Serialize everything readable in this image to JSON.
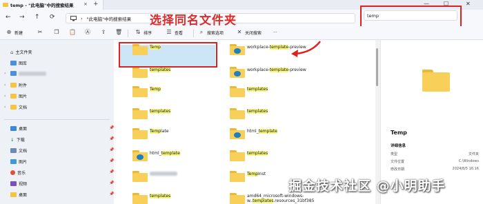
{
  "window": {
    "tab_title": "temp - \"此电脑\"中的搜索结果",
    "tab_close": "×",
    "tab_add": "+",
    "minimize": "—",
    "maximize": "☐",
    "close": "✕"
  },
  "nav": {
    "back": "←",
    "forward": "→",
    "up": "↑",
    "refresh": "⟳",
    "computer_icon": "computer-icon",
    "breadcrumb_sep": "›",
    "breadcrumb": "\"此电脑\"中的搜索结果"
  },
  "annotation": {
    "title": "选择同名文件夹"
  },
  "search": {
    "value": "temp"
  },
  "toolbar": {
    "new_label": "新建",
    "sort_label": "排序",
    "view_label": "查看",
    "search_options_label": "搜索选项",
    "close_search_label": "关闭搜索",
    "more_label": "..."
  },
  "sidebar": {
    "home": "主文件夹",
    "gallery": "图库",
    "attachments": "附件",
    "pictures": "图片",
    "documents": "文档",
    "desktop": "桌面",
    "downloads": "下载",
    "documents2": "文档",
    "pictures2": "图片",
    "music": "音乐",
    "videos": "视频",
    "desktop2": "桌面",
    "chevron": "›",
    "pin": "📌"
  },
  "files": {
    "col1": [
      {
        "pre": "",
        "hl": "Temp",
        "post": ""
      },
      {
        "pre": "",
        "hl": "templates",
        "post": ""
      },
      {
        "pre": "",
        "hl": "Temp",
        "post": ""
      },
      {
        "pre": "",
        "hl": "templates",
        "post": ""
      },
      {
        "pre": "",
        "hl": "Temp",
        "post": "late"
      },
      {
        "pre": "html_",
        "hl": "template",
        "post": ""
      },
      {
        "pre": "",
        "hl": "",
        "post": ""
      },
      {
        "pre": "",
        "hl": "templates",
        "post": ""
      }
    ],
    "col2": [
      {
        "pre": "workplace-",
        "hl": "template",
        "post": "-preview"
      },
      {
        "pre": "workplace-",
        "hl": "template",
        "post": "-preview"
      },
      {
        "pre": "",
        "hl": "templates",
        "post": ""
      },
      {
        "pre": "",
        "hl": "templates",
        "post": ""
      },
      {
        "pre": "html_",
        "hl": "template",
        "post": ""
      },
      {
        "pre": "",
        "hl": "templates",
        "post": ""
      },
      {
        "pre": "",
        "hl": "Temp",
        "post": "Inst"
      },
      {
        "pre": "amd64_microsoft-windows-",
        "hl": "",
        "post": ""
      }
    ],
    "col2_last_line2": {
      "pre": "w..",
      "hl": "templates",
      "post": ".resources_31bf385"
    }
  },
  "details": {
    "name": "Temp",
    "section": "详细信息",
    "rows": [
      {
        "label": "类型",
        "value": "文件夹"
      },
      {
        "label": "文件位置",
        "value": "C:\\Windows"
      },
      {
        "label": "修改日期",
        "value": "2024/8/5 16:16"
      }
    ]
  },
  "watermark": "掘金技术社区 @小明助手"
}
